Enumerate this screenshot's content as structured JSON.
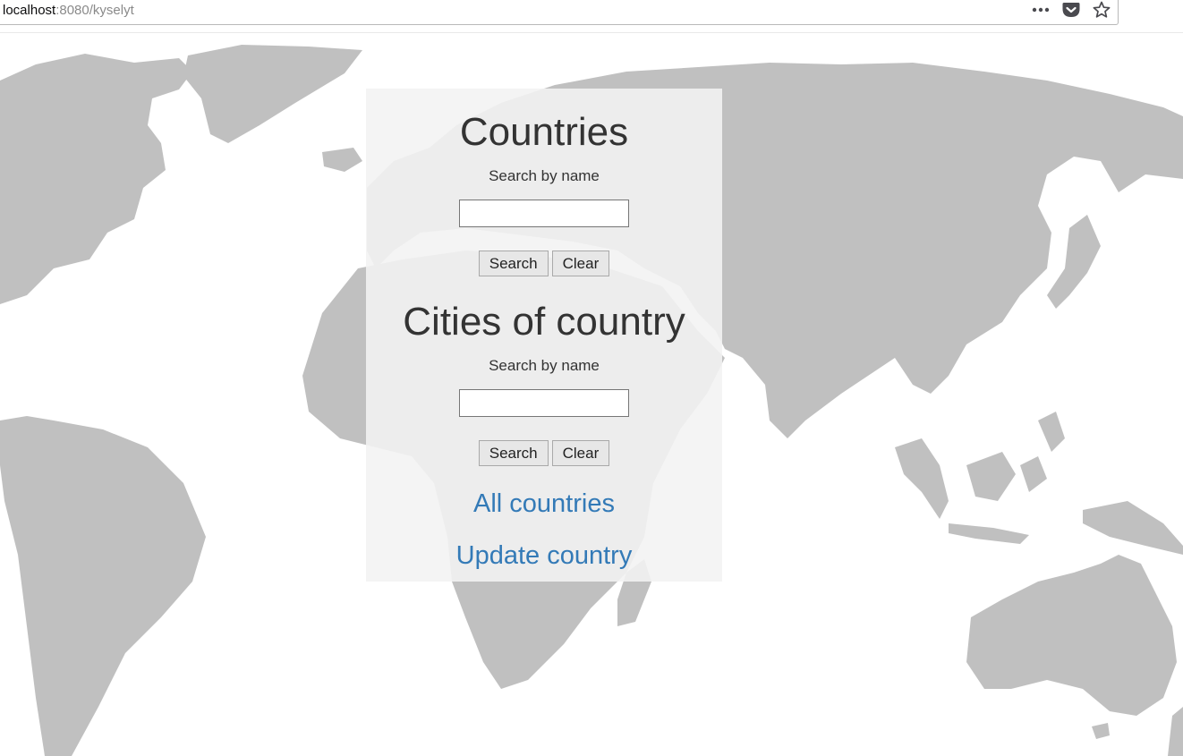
{
  "browser": {
    "url_host": "localhost",
    "url_path": ":8080/kyselyt",
    "icons": [
      "more-icon",
      "pocket-icon",
      "bookmark-star-icon"
    ]
  },
  "countries": {
    "title": "Countries",
    "search_label": "Search by name",
    "input_value": "",
    "input_placeholder": "",
    "search_button": "Search",
    "clear_button": "Clear"
  },
  "cities": {
    "title": "Cities of country",
    "search_label": "Search by name",
    "input_value": "",
    "input_placeholder": "",
    "search_button": "Search",
    "clear_button": "Clear"
  },
  "links": {
    "all_countries": "All countries",
    "update_country": "Update country"
  },
  "colors": {
    "map_land": "#c0c0c0",
    "link": "#337ab7",
    "panel_bg": "#f3f3f3",
    "heading_text": "#333333"
  }
}
